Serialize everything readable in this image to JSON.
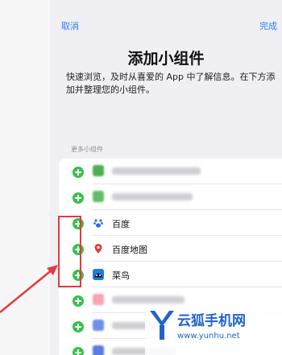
{
  "nav": {
    "cancel_label": "取消",
    "done_label": "完成"
  },
  "header": {
    "title": "添加小组件",
    "description": "快速浏览，及时从喜爱的 App 中了解信息。在下方添加并整理您的小组件。"
  },
  "section": {
    "title": "更多小组件"
  },
  "widgets": [
    {
      "label": "",
      "icon": "app-blurred-green-icon",
      "color": "#4caf50",
      "blurred": true
    },
    {
      "label": "",
      "icon": "app-blurred-green-icon",
      "color": "#66bb6a",
      "blurred": true
    },
    {
      "label": "百度",
      "icon": "baidu-paw-icon",
      "color": "#2d6cdf",
      "blurred": false
    },
    {
      "label": "百度地图",
      "icon": "map-pin-icon",
      "color": "#e53935",
      "blurred": false
    },
    {
      "label": "菜鸟",
      "icon": "cainiao-bird-icon",
      "color": "#1f7ae0",
      "blurred": false
    },
    {
      "label": "",
      "icon": "app-blurred-pink-icon",
      "color": "#f6a5b5",
      "blurred": true
    },
    {
      "label": "",
      "icon": "app-blurred-blue-icon",
      "color": "#6f8fe8",
      "blurred": true
    },
    {
      "label": "",
      "icon": "app-blurred-blue-icon",
      "color": "#5a7be0",
      "blurred": true
    }
  ],
  "watermark": {
    "title": "云狐手机网",
    "url": "www.yunhu.net"
  },
  "colors": {
    "accent": "#2f7bf6",
    "add_green": "#35c24a",
    "annotation_red": "#e5393b"
  }
}
